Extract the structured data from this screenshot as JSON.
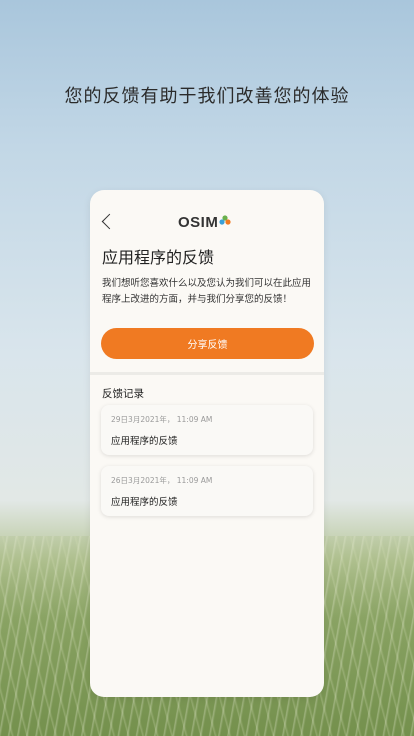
{
  "headline": "您的反馈有助于我们改善您的体验",
  "header": {
    "logo_text": "OSIM",
    "back_icon": "chevron-left-icon",
    "logo_icon": "osim-flower-icon",
    "logo_colors": [
      "#3aa0d8",
      "#f07a22",
      "#6ab04c"
    ]
  },
  "page": {
    "title": "应用程序的反馈",
    "description": "我们想听您喜欢什么以及您认为我们可以在此应用程序上改进的方面，并与我们分享您的反馈！",
    "share_button": "分享反馈"
  },
  "records": {
    "title": "反馈记录",
    "items": [
      {
        "date": "29日3月2021年，  11:09 AM",
        "name": "应用程序的反馈"
      },
      {
        "date": "26日3月2021年，  11:09 AM",
        "name": "应用程序的反馈"
      }
    ]
  },
  "colors": {
    "accent": "#f07a22",
    "card_background": "#fbf9f5"
  }
}
